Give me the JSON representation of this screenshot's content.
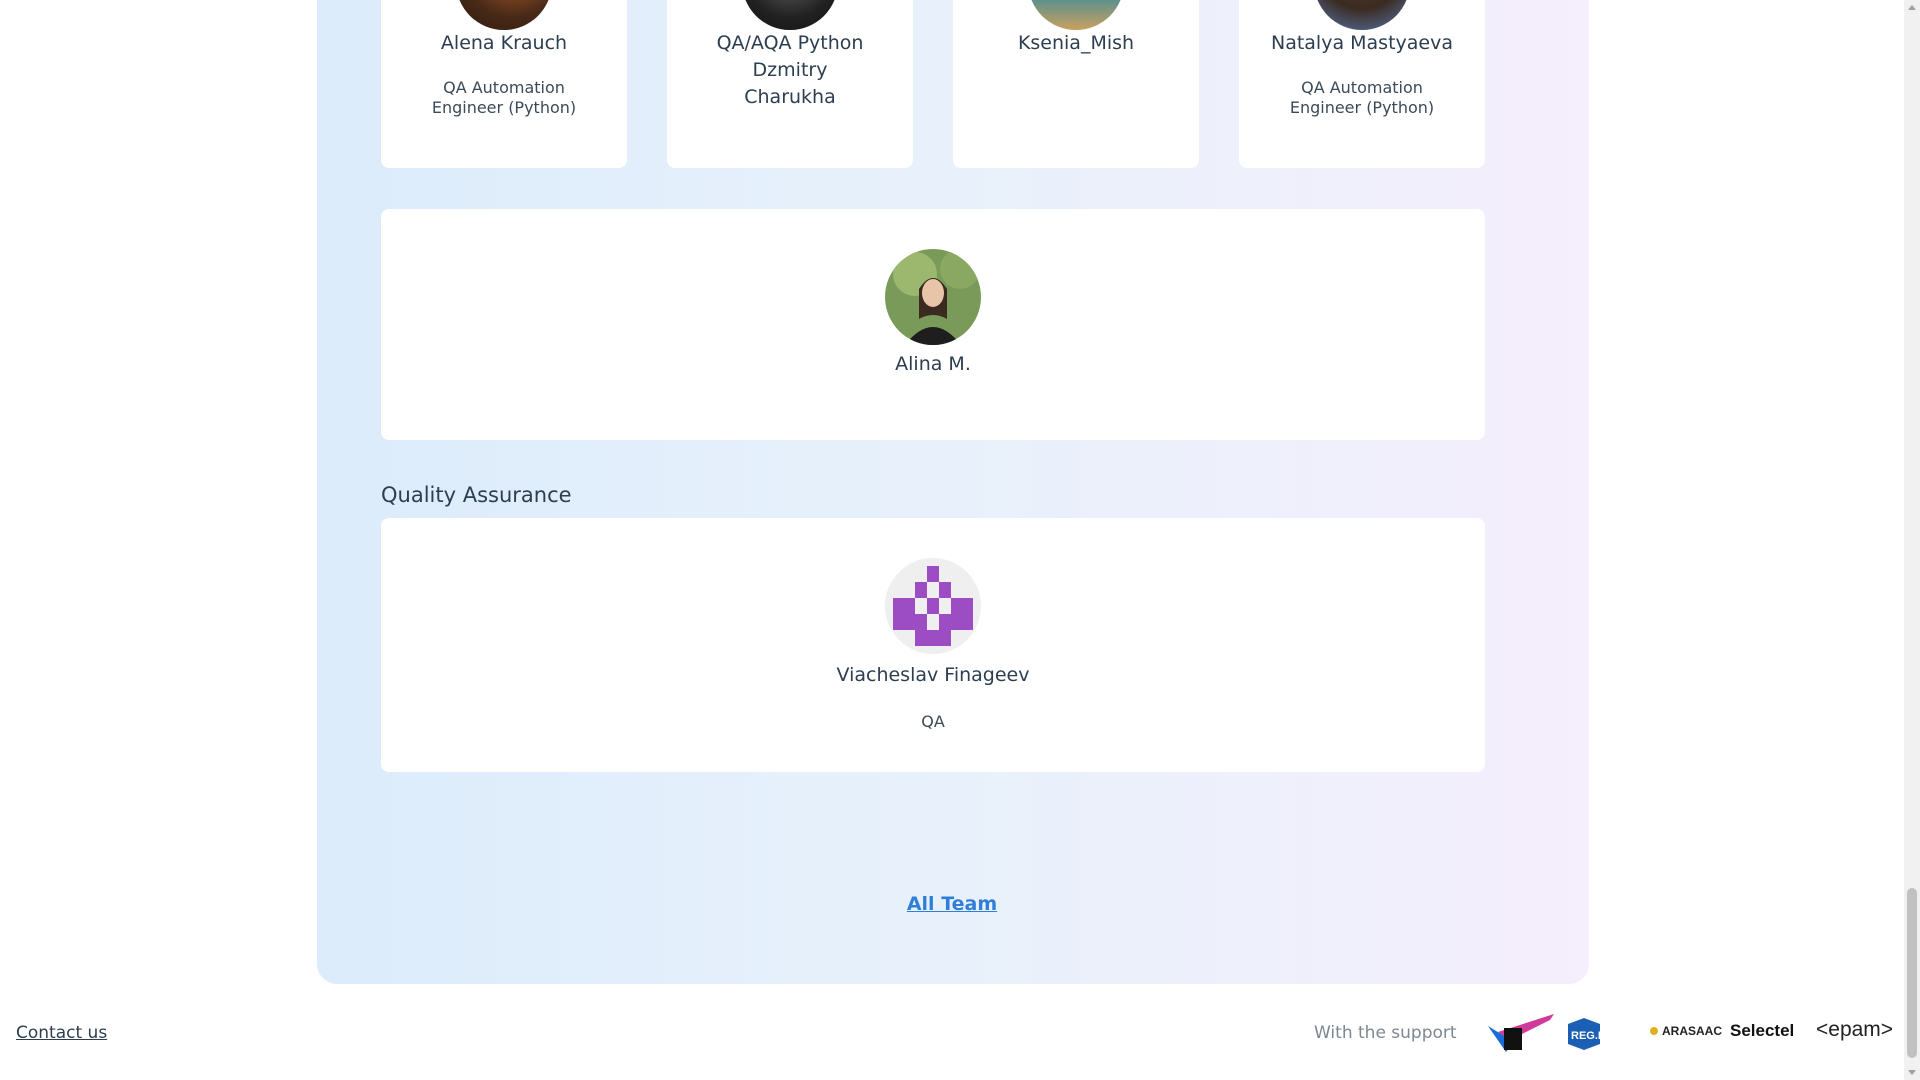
{
  "team_cards": [
    {
      "name": "Alena Krauch",
      "role": "QA Automation Engineer (Python)"
    },
    {
      "name": "QA/AQA Python Dzmitry Charukha",
      "role": ""
    },
    {
      "name": "Ksenia_Mish",
      "role": ""
    },
    {
      "name": "Natalya Mastyaeva",
      "role": "QA Automation Engineer (Python)"
    }
  ],
  "wide_card": {
    "name": "Alina M."
  },
  "qa_section": {
    "title": "Quality Assurance",
    "member": {
      "name": "Viacheslav Finageev",
      "role": "QA"
    }
  },
  "all_team_link": "All Team",
  "footer": {
    "contact": "Contact us",
    "support_label": "With the support",
    "sponsors": [
      "REG.RU",
      "ARASAAC",
      "Selectel",
      "<epam>"
    ]
  },
  "colors": {
    "link": "#2f7fd8",
    "panel_start": "#dcecfb",
    "panel_end": "#f5eefc",
    "identicon": "#9c4dc4"
  }
}
